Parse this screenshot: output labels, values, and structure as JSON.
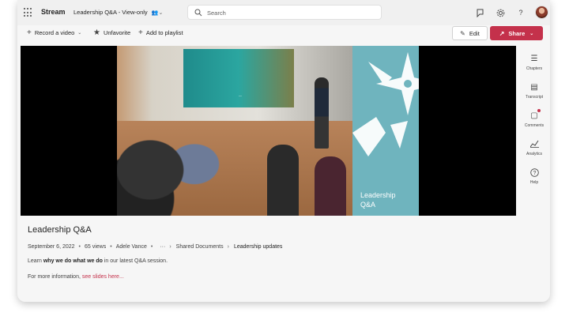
{
  "app": {
    "name": "Stream"
  },
  "document": {
    "title": "Leadership Q&A - View-only"
  },
  "search": {
    "placeholder": "Search"
  },
  "toolbar": {
    "record_video": "Record a video",
    "unfavorite": "Unfavorite",
    "add_to_playlist": "Add to playlist",
    "edit": "Edit",
    "share": "Share"
  },
  "video": {
    "brand_title_line1": "Leadership",
    "brand_title_line2": "Q&A"
  },
  "rail": {
    "items": [
      {
        "label": "Chapters",
        "icon": "chapters-icon"
      },
      {
        "label": "Transcript",
        "icon": "transcript-icon"
      },
      {
        "label": "Comments",
        "icon": "comments-icon"
      },
      {
        "label": "Analytics",
        "icon": "analytics-icon"
      },
      {
        "label": "Help",
        "icon": "help-icon"
      }
    ]
  },
  "details": {
    "title": "Leadership Q&A",
    "date": "September 6, 2022",
    "views": "65 views",
    "author": "Adele Vance",
    "ellipsis": "···",
    "crumb_folder": "Shared Documents",
    "crumb_current": "Leadership updates",
    "desc_prefix": "Learn ",
    "desc_bold": "why we do what we do",
    "desc_suffix": " in our latest Q&A session.",
    "more_prefix": "For more information, ",
    "more_link": "see slides here..."
  },
  "colors": {
    "accent": "#c4314b",
    "brand_teal": "#6fb4be"
  }
}
